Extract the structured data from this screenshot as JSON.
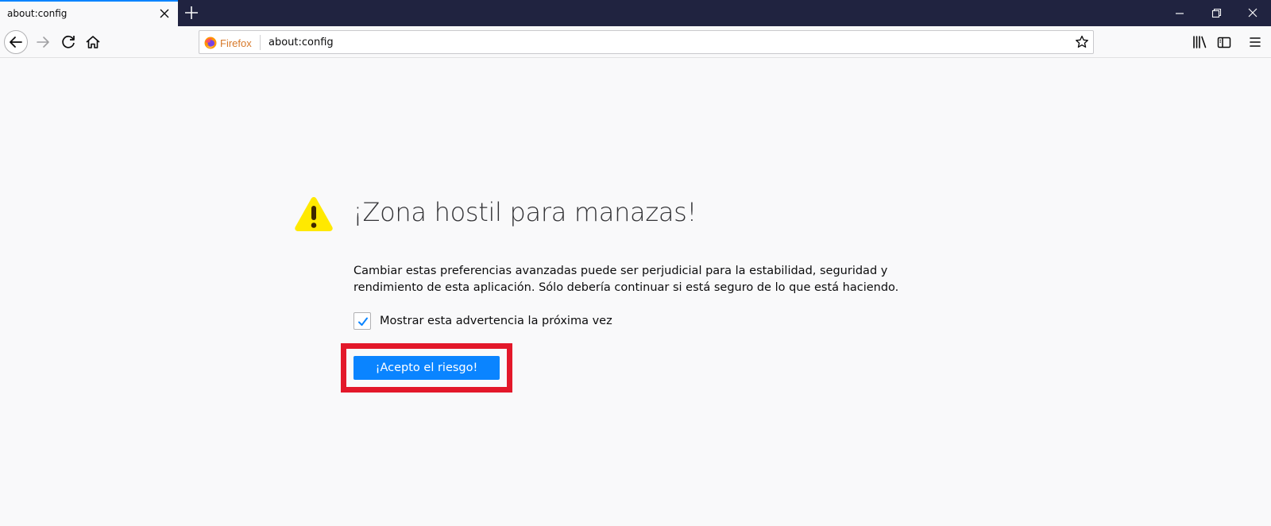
{
  "tab": {
    "title": "about:config"
  },
  "urlbar": {
    "identity_label": "Firefox",
    "url": "about:config"
  },
  "warning": {
    "title": "¡Zona hostil para manazas!",
    "description": "Cambiar estas preferencias avanzadas puede ser perjudicial para la estabilidad, seguridad y rendimiento de esta aplicación. Sólo debería continuar si está seguro de lo que está haciendo.",
    "checkbox_label": "Mostrar esta advertencia la próxima vez",
    "checkbox_checked": true,
    "accept_button": "¡Acepto el riesgo!"
  },
  "colors": {
    "accent": "#0a84ff",
    "tabstrip": "#202340",
    "highlight": "#e3182a",
    "warning_icon": "#ffe900"
  }
}
